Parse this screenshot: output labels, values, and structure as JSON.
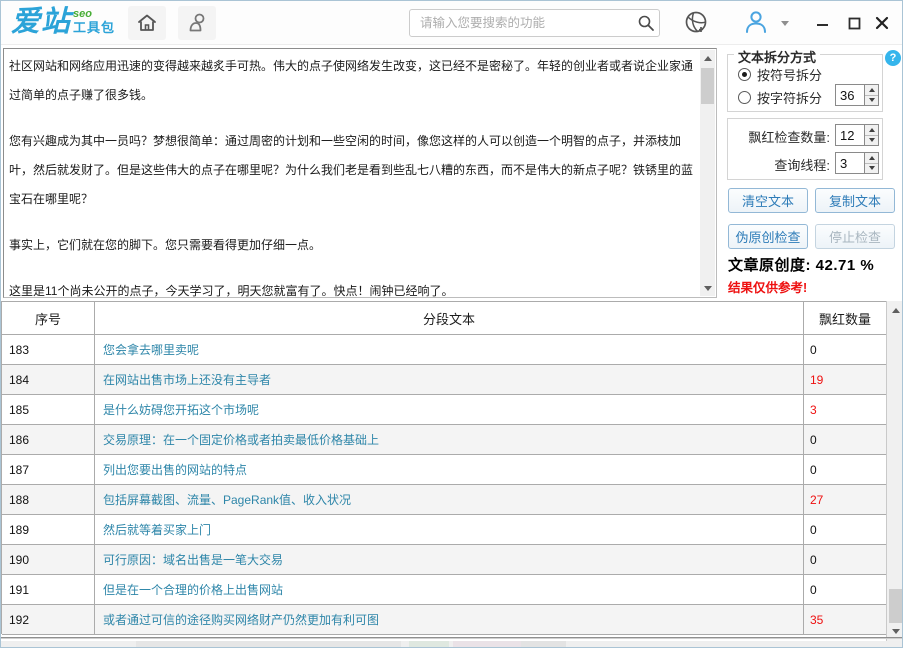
{
  "brand": {
    "name": "爱站",
    "sup": "seo",
    "sub": "工具包"
  },
  "topbar": {
    "search_placeholder": "请输入您要搜索的功能",
    "icons": {
      "home": "house",
      "contacts": "person-outline",
      "search": "magnifier",
      "network": "globe",
      "user": "person-blue",
      "minimize": "minimize-bar",
      "maximize": "square-outline",
      "close": "x-cross"
    }
  },
  "editor": {
    "paragraphs": [
      "社区网站和网络应用迅速的变得越来越炙手可热。伟大的点子使网络发生改变，这已经不是密秘了。年轻的创业者或者说企业家通过简单的点子赚了很多钱。",
      "您有兴趣成为其中一员吗？梦想很简单：通过周密的计划和一些空闲的时间，像您这样的人可以创造一个明智的点子，并添枝加叶，然后就发财了。但是这些伟大的点子在哪里呢？为什么我们老是看到些乱七八糟的东西，而不是伟大的新点子呢？铁锈里的蓝宝石在哪里呢？",
      "事实上，它们就在您的脚下。您只需要看得更加仔细一点。",
      "这里是11个尚未公开的点子，今天学习了，明天您就富有了。快点！闹钟已经响了。"
    ]
  },
  "settings": {
    "split_group_title": "文本拆分方式",
    "help_glyph": "?",
    "radio_symbol_label": "按符号拆分",
    "radio_symbol_selected": true,
    "radio_char_label": "按字符拆分",
    "radio_char_selected": false,
    "char_split_value": "36",
    "red_check_label": "飘红检查数量:",
    "red_check_value": "12",
    "thread_label": "查询线程:",
    "thread_value": "3",
    "clear_btn": "清空文本",
    "copy_btn": "复制文本",
    "check_btn": "伪原创检查",
    "stop_btn": "停止检查",
    "originality_label": "文章原创度:",
    "originality_value": "42.71 %",
    "disclaimer": "结果仅供参考!"
  },
  "table": {
    "headers": [
      "序号",
      "分段文本",
      "飘红数量"
    ],
    "rows": [
      {
        "id": "183",
        "text": "您会拿去哪里卖呢",
        "count": "0"
      },
      {
        "id": "184",
        "text": "在网站出售市场上还没有主导者",
        "count": "19"
      },
      {
        "id": "185",
        "text": "是什么妨碍您开拓这个市场呢",
        "count": "3"
      },
      {
        "id": "186",
        "text": "交易原理：在一个固定价格或者拍卖最低价格基础上",
        "count": "0"
      },
      {
        "id": "187",
        "text": "列出您要出售的网站的特点",
        "count": "0"
      },
      {
        "id": "188",
        "text": "包括屏幕截图、流量、PageRank值、收入状况",
        "count": "27"
      },
      {
        "id": "189",
        "text": "然后就等着买家上门",
        "count": "0"
      },
      {
        "id": "190",
        "text": "可行原因：域名出售是一笔大交易",
        "count": "0"
      },
      {
        "id": "191",
        "text": "但是在一个合理的价格上出售网站",
        "count": "0"
      },
      {
        "id": "192",
        "text": "或者通过可信的途径购买网络财产仍然更加有利可图",
        "count": "35"
      }
    ]
  },
  "colors": {
    "brand_blue": "#2ba3d8",
    "brand_green": "#47ad35",
    "link_teal": "#2e86a9",
    "alert_red": "#ee1111",
    "button_blue": "#2e7cb8",
    "help_blue": "#35b5ec"
  }
}
